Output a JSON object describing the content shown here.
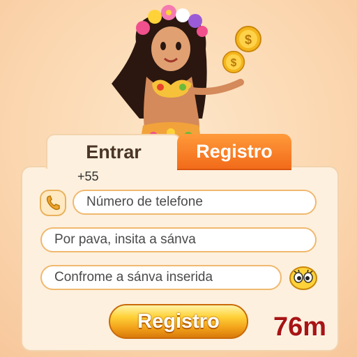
{
  "tabs": {
    "login_label": "Entrar",
    "register_label": "Registro"
  },
  "phone": {
    "prefix": "+55",
    "placeholder": "Número de telefone"
  },
  "password": {
    "placeholder": "Por pava, insita a sánva"
  },
  "confirm_password": {
    "placeholder": "Confrome a sánva inserida"
  },
  "submit": {
    "label": "Registro"
  },
  "timer": {
    "text": "76m"
  },
  "colors": {
    "accent": "#f26b1a",
    "field_border": "#f0b86e",
    "timer": "#a81414"
  },
  "icons": [
    "coin-icon",
    "phone-icon",
    "eye-icon"
  ]
}
